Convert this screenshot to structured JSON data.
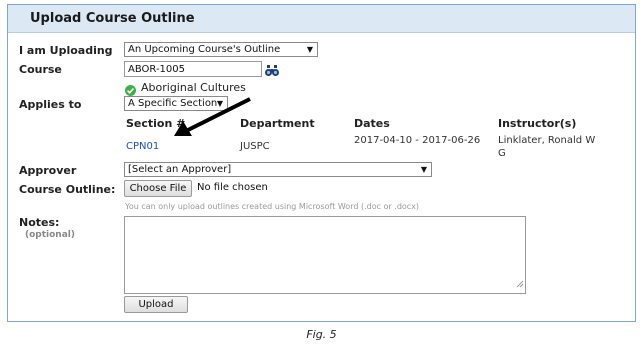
{
  "panel": {
    "title": "Upload Course Outline"
  },
  "form": {
    "uploading": {
      "label": "I am Uploading",
      "selected": "An Upcoming Course's Outline"
    },
    "course": {
      "label": "Course",
      "value": "ABOR-1005",
      "lookup_icon": "binoculars-icon",
      "match_icon": "check-circle-icon",
      "match_text": "Aboriginal Cultures"
    },
    "applies_to": {
      "label": "Applies to",
      "selected": "A Specific Section"
    },
    "sections": {
      "headers": [
        "Section #",
        "Department",
        "Dates",
        "Instructor(s)"
      ],
      "rows": [
        {
          "section": "CPN01",
          "department": "JUSPC",
          "dates": "2017-04-10 - 2017-06-26",
          "instructor_line1": "Linklater, Ronald W",
          "instructor_line2": "G"
        }
      ]
    },
    "approver": {
      "label": "Approver",
      "selected": "[Select an Approver]"
    },
    "outline": {
      "label": "Course Outline:",
      "button": "Choose File",
      "status": "No file chosen",
      "hint": "You can only upload outlines created using Microsoft Word (.doc or .docx)"
    },
    "notes": {
      "label": "Notes:",
      "sublabel": "(optional)",
      "value": ""
    },
    "upload_button": "Upload"
  },
  "annotation": {
    "arrow_icon": "arrow-pointer-icon",
    "arrow_color": "#000000"
  },
  "caption": "Fig. 5",
  "colors": {
    "header_bg": "#dce8f4",
    "border": "#7fa7c9",
    "link": "#1a4fbf",
    "check": "#3fae49"
  }
}
